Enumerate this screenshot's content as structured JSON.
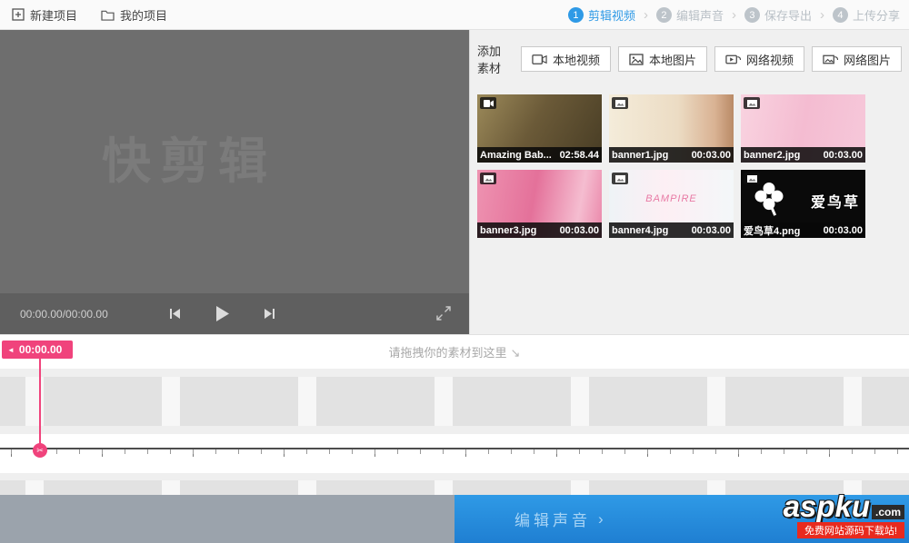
{
  "colors": {
    "accent_blue": "#2f9ae6",
    "accent_pink": "#f0437c"
  },
  "topbar": {
    "new_project": "新建项目",
    "my_projects": "我的项目",
    "steps": [
      {
        "num": "1",
        "label": "剪辑视频"
      },
      {
        "num": "2",
        "label": "编辑声音"
      },
      {
        "num": "3",
        "label": "保存导出"
      },
      {
        "num": "4",
        "label": "上传分享"
      }
    ]
  },
  "preview": {
    "watermark": "快剪辑",
    "timecode": "00:00.00/00:00.00"
  },
  "materials": {
    "add_label": "添加素材",
    "buttons": [
      {
        "label": "本地视频"
      },
      {
        "label": "本地图片"
      },
      {
        "label": "网络视频"
      },
      {
        "label": "网络图片"
      }
    ],
    "items": [
      {
        "name": "Amazing Bab...",
        "duration": "02:58.44",
        "type": "video"
      },
      {
        "name": "banner1.jpg",
        "duration": "00:03.00",
        "type": "image"
      },
      {
        "name": "banner2.jpg",
        "duration": "00:03.00",
        "type": "image"
      },
      {
        "name": "banner3.jpg",
        "duration": "00:03.00",
        "type": "image"
      },
      {
        "name": "banner4.jpg",
        "duration": "00:03.00",
        "type": "image",
        "overlay": "BAMPIRE"
      },
      {
        "name": "爱鸟草4.png",
        "duration": "00:03.00",
        "type": "image",
        "overlay": "爱鸟草"
      }
    ]
  },
  "timeline": {
    "playhead_time": "00:00.00",
    "drop_hint": "请拖拽你的素材到这里"
  },
  "bottom": {
    "next_step": "编辑声音"
  },
  "watermark_logo": {
    "brand": "aspku",
    "tld": ".com",
    "tagline": "免费网站源码下载站!"
  }
}
